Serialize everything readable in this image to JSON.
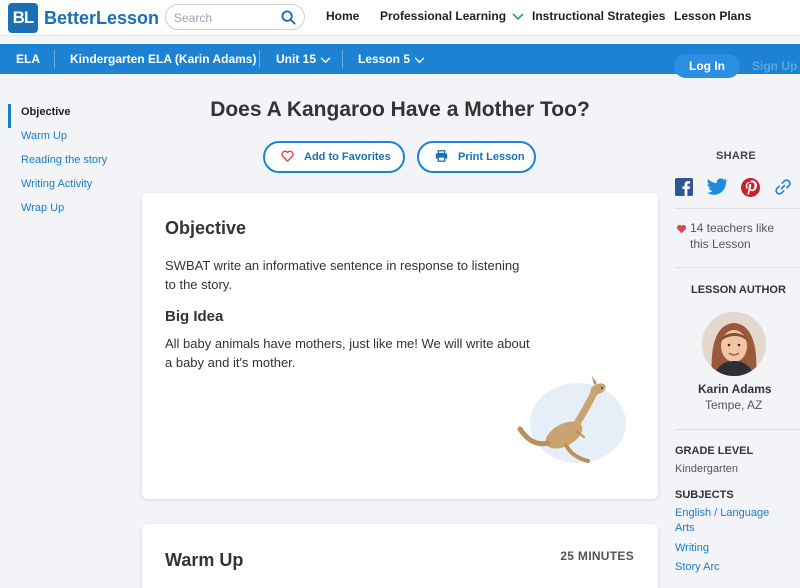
{
  "brand": {
    "mark": "BL",
    "name": "BetterLesson"
  },
  "search": {
    "placeholder": "Search"
  },
  "topnav": {
    "home": "Home",
    "professional_learning": "Professional Learning",
    "instructional_strategies": "Instructional Strategies",
    "lesson_plans": "Lesson Plans"
  },
  "breadcrumb": {
    "subject": "ELA",
    "course": "Kindergarten ELA (Karin Adams)",
    "unit": "Unit 15",
    "lesson": "Lesson 5"
  },
  "auth": {
    "login": "Log In",
    "signup": "Sign Up"
  },
  "sidebar": {
    "items": [
      {
        "label": "Objective"
      },
      {
        "label": "Warm Up"
      },
      {
        "label": "Reading the story"
      },
      {
        "label": "Writing Activity"
      },
      {
        "label": "Wrap Up"
      }
    ]
  },
  "lesson": {
    "title": "Does A Kangaroo Have a Mother Too?",
    "favorite_label": "Add to Favorites",
    "print_label": "Print Lesson"
  },
  "objective_card": {
    "heading": "Objective",
    "text": " SWBAT write an informative sentence in response to listening to the story.",
    "big_idea_heading": "Big Idea",
    "big_idea_text": "All baby animals have mothers, just like me! We will write about a baby and it's mother."
  },
  "warmup_card": {
    "heading": "Warm Up",
    "duration": "25 MINUTES"
  },
  "share": {
    "label": "SHARE",
    "icons": [
      "facebook-icon",
      "twitter-icon",
      "pinterest-icon",
      "link-icon"
    ]
  },
  "likes": {
    "text": "14 teachers like this Lesson"
  },
  "author": {
    "label": "LESSON AUTHOR",
    "name": "Karin Adams",
    "location": "Tempe, AZ"
  },
  "grade": {
    "label": "GRADE LEVEL",
    "value": "Kindergarten"
  },
  "subjects": {
    "label": "SUBJECTS",
    "items": [
      "English / Language Arts",
      "Writing",
      "Story Arc"
    ]
  },
  "colors": {
    "brand": "#1a6fb5",
    "accent": "#1d82d2",
    "link": "#1a7cc7",
    "heart": "#e0454f"
  }
}
